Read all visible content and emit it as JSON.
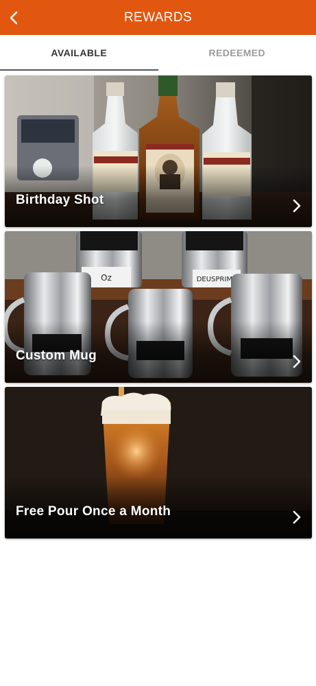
{
  "header": {
    "title": "REWARDS",
    "back_icon": "chevron-left-icon",
    "background": "#e2570f"
  },
  "tabs": [
    {
      "label": "AVAILABLE",
      "active": true
    },
    {
      "label": "REDEEMED",
      "active": false
    }
  ],
  "rewards": [
    {
      "title": "Birthday Shot",
      "icon": "chevron-right-icon"
    },
    {
      "title": "Custom Mug",
      "icon": "chevron-right-icon"
    },
    {
      "title": "Free Pour Once a Month",
      "icon": "chevron-right-icon"
    }
  ]
}
